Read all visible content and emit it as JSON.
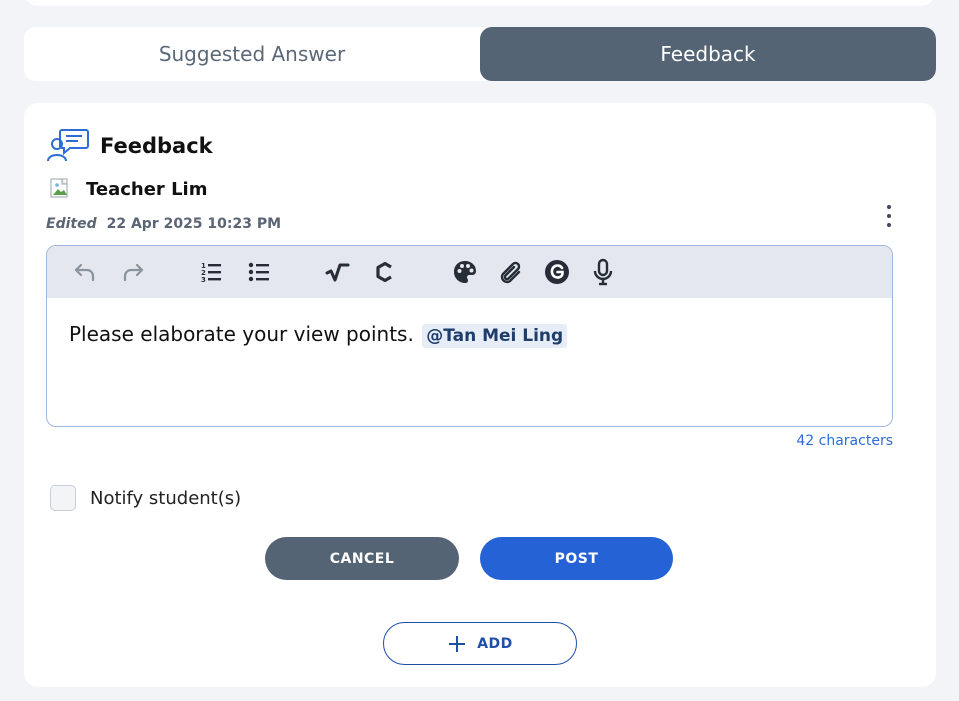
{
  "tabs": [
    {
      "label": "Suggested Answer",
      "active": false
    },
    {
      "label": "Feedback",
      "active": true
    }
  ],
  "panel": {
    "title": "Feedback",
    "icon": "feedback-chat-icon"
  },
  "author": {
    "name": "Teacher Lim",
    "avatar": "broken-image-icon"
  },
  "meta": {
    "edited_label": "Edited",
    "timestamp": "22 Apr 2025 10:23 PM"
  },
  "toolbar": {
    "icons": [
      "undo-icon",
      "redo-icon",
      "numbered-list-icon",
      "bulleted-list-icon",
      "math-sqrt-icon",
      "chemistry-icon",
      "palette-icon",
      "attachment-icon",
      "grammarly-icon",
      "microphone-icon"
    ]
  },
  "editor": {
    "text": "Please elaborate your view points.",
    "mention": "@Tan Mei Ling",
    "char_count": "42 characters"
  },
  "notify": {
    "label": "Notify student(s)",
    "checked": false
  },
  "buttons": {
    "cancel": "CANCEL",
    "post": "POST",
    "add": "ADD"
  },
  "colors": {
    "accent": "#2462d6",
    "tab_active": "#546474",
    "background": "#f3f4f7"
  }
}
